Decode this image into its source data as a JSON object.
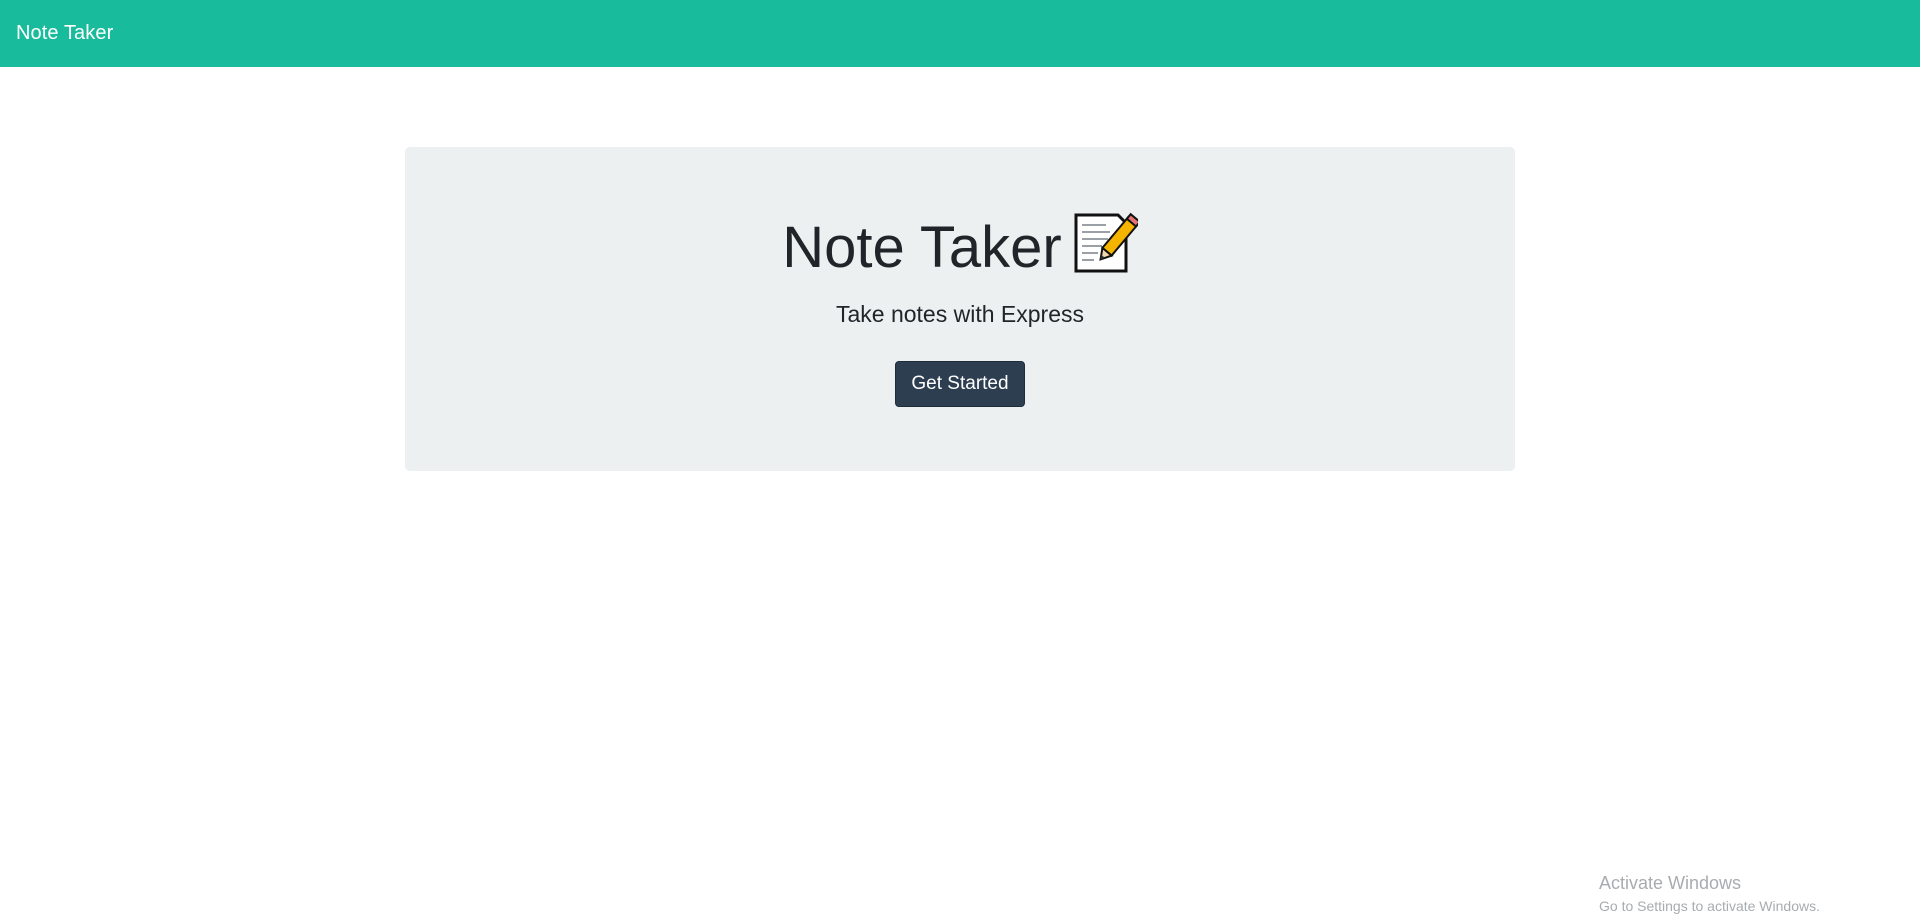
{
  "navbar": {
    "brand": "Note Taker",
    "background": "#18bc9c"
  },
  "hero": {
    "title": "Note Taker",
    "title_icon": "memo-icon",
    "subtitle": "Take notes with Express",
    "button_label": "Get Started",
    "background": "#ecf0f1",
    "button_color": "#2c3e50"
  },
  "watermark": {
    "title": "Activate Windows",
    "subtitle": "Go to Settings to activate Windows."
  }
}
